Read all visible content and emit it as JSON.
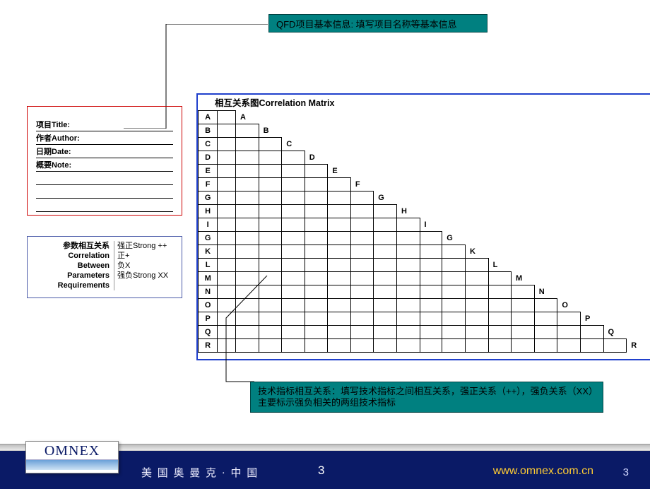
{
  "callouts": {
    "top": "QFD项目基本信息: 填写项目名称等基本信息",
    "bottom": "技术指标相互关系：填写技术指标之间相互关系，强正关系（++），强负关系（XX）主要标示强负相关的两组技术指标"
  },
  "info": {
    "f1": "项目Title:",
    "f2": "作者Author:",
    "f3": "日期Date:",
    "f4": "概要Note:"
  },
  "legend": {
    "title_lines": [
      "参数相互关系",
      "Correlation",
      "Between",
      "Parameters",
      "Requirements"
    ],
    "levels": [
      "强正Strong ++",
      "正+",
      "负X",
      "强负Strong XX"
    ]
  },
  "matrix": {
    "title": "相互关系图Correlation Matrix",
    "rows": [
      "A",
      "B",
      "C",
      "D",
      "E",
      "F",
      "G",
      "H",
      "I",
      "G",
      "K",
      "L",
      "M",
      "N",
      "O",
      "P",
      "Q",
      "R"
    ],
    "diag": [
      "A",
      "B",
      "C",
      "D",
      "E",
      "F",
      "G",
      "H",
      "I",
      "G",
      "K",
      "L",
      "M",
      "N",
      "O",
      "P",
      "Q",
      "R"
    ]
  },
  "footer": {
    "brand": "OMNEX",
    "cn": "美 国 奥 曼 克 · 中 国",
    "page": "3",
    "url": "www.omnex.com.cn",
    "page2": "3"
  }
}
